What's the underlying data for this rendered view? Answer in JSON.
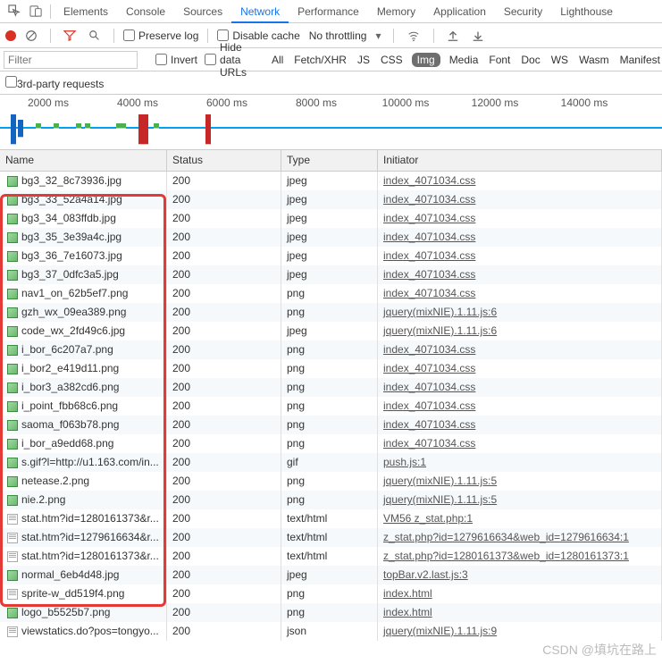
{
  "tabs": [
    "Elements",
    "Console",
    "Sources",
    "Network",
    "Performance",
    "Memory",
    "Application",
    "Security",
    "Lighthouse"
  ],
  "active_tab": "Network",
  "toolbar": {
    "preserve": "Preserve log",
    "disable": "Disable cache",
    "throttle": "No throttling"
  },
  "filter": {
    "placeholder": "Filter",
    "invert": "Invert",
    "hide": "Hide data URLs",
    "types": [
      "All",
      "Fetch/XHR",
      "JS",
      "CSS",
      "Img",
      "Media",
      "Font",
      "Doc",
      "WS",
      "Wasm",
      "Manifest"
    ],
    "active_type": "Img",
    "third": "3rd-party requests"
  },
  "timeline": [
    "2000 ms",
    "4000 ms",
    "6000 ms",
    "8000 ms",
    "10000 ms",
    "12000 ms",
    "14000 ms"
  ],
  "columns": {
    "name": "Name",
    "status": "Status",
    "type": "Type",
    "init": "Initiator"
  },
  "rows": [
    {
      "n": "bg3_32_8c73936.jpg",
      "s": "200",
      "t": "jpeg",
      "i": "index_4071034.css",
      "ic": "img"
    },
    {
      "n": "bg3_33_52a4a14.jpg",
      "s": "200",
      "t": "jpeg",
      "i": "index_4071034.css",
      "ic": "img"
    },
    {
      "n": "bg3_34_083ffdb.jpg",
      "s": "200",
      "t": "jpeg",
      "i": "index_4071034.css",
      "ic": "img"
    },
    {
      "n": "bg3_35_3e39a4c.jpg",
      "s": "200",
      "t": "jpeg",
      "i": "index_4071034.css",
      "ic": "img"
    },
    {
      "n": "bg3_36_7e16073.jpg",
      "s": "200",
      "t": "jpeg",
      "i": "index_4071034.css",
      "ic": "img"
    },
    {
      "n": "bg3_37_0dfc3a5.jpg",
      "s": "200",
      "t": "jpeg",
      "i": "index_4071034.css",
      "ic": "img"
    },
    {
      "n": "nav1_on_62b5ef7.png",
      "s": "200",
      "t": "png",
      "i": "index_4071034.css",
      "ic": "img"
    },
    {
      "n": "gzh_wx_09ea389.png",
      "s": "200",
      "t": "png",
      "i": "jquery(mixNIE).1.11.js:6",
      "ic": "img"
    },
    {
      "n": "code_wx_2fd49c6.jpg",
      "s": "200",
      "t": "jpeg",
      "i": "jquery(mixNIE).1.11.js:6",
      "ic": "img"
    },
    {
      "n": "i_bor_6c207a7.png",
      "s": "200",
      "t": "png",
      "i": "index_4071034.css",
      "ic": "img"
    },
    {
      "n": "i_bor2_e419d11.png",
      "s": "200",
      "t": "png",
      "i": "index_4071034.css",
      "ic": "img"
    },
    {
      "n": "i_bor3_a382cd6.png",
      "s": "200",
      "t": "png",
      "i": "index_4071034.css",
      "ic": "img"
    },
    {
      "n": "i_point_fbb68c6.png",
      "s": "200",
      "t": "png",
      "i": "index_4071034.css",
      "ic": "img"
    },
    {
      "n": "saoma_f063b78.png",
      "s": "200",
      "t": "png",
      "i": "index_4071034.css",
      "ic": "img"
    },
    {
      "n": "i_bor_a9edd68.png",
      "s": "200",
      "t": "png",
      "i": "index_4071034.css",
      "ic": "img"
    },
    {
      "n": "s.gif?l=http://u1.163.com/in...",
      "s": "200",
      "t": "gif",
      "i": "push.js:1",
      "ic": "img"
    },
    {
      "n": "netease.2.png",
      "s": "200",
      "t": "png",
      "i": "jquery(mixNIE).1.11.js:5",
      "ic": "img"
    },
    {
      "n": "nie.2.png",
      "s": "200",
      "t": "png",
      "i": "jquery(mixNIE).1.11.js:5",
      "ic": "img"
    },
    {
      "n": "stat.htm?id=1280161373&r...",
      "s": "200",
      "t": "text/html",
      "i": "VM56 z_stat.php:1",
      "ic": "doc"
    },
    {
      "n": "stat.htm?id=1279616634&r...",
      "s": "200",
      "t": "text/html",
      "i": "z_stat.php?id=1279616634&web_id=1279616634:1",
      "ic": "doc"
    },
    {
      "n": "stat.htm?id=1280161373&r...",
      "s": "200",
      "t": "text/html",
      "i": "z_stat.php?id=1280161373&web_id=1280161373:1",
      "ic": "doc"
    },
    {
      "n": "normal_6eb4d48.jpg",
      "s": "200",
      "t": "jpeg",
      "i": "topBar.v2.last.js:3",
      "ic": "img"
    },
    {
      "n": "sprite-w_dd519f4.png",
      "s": "200",
      "t": "png",
      "i": "index.html",
      "ic": "doc"
    },
    {
      "n": "logo_b5525b7.png",
      "s": "200",
      "t": "png",
      "i": "index.html",
      "ic": "img"
    },
    {
      "n": "viewstatics.do?pos=tongyo...",
      "s": "200",
      "t": "json",
      "i": "jquery(mixNIE).1.11.js:9",
      "ic": "doc"
    }
  ],
  "watermark": "CSDN @填坑在路上"
}
